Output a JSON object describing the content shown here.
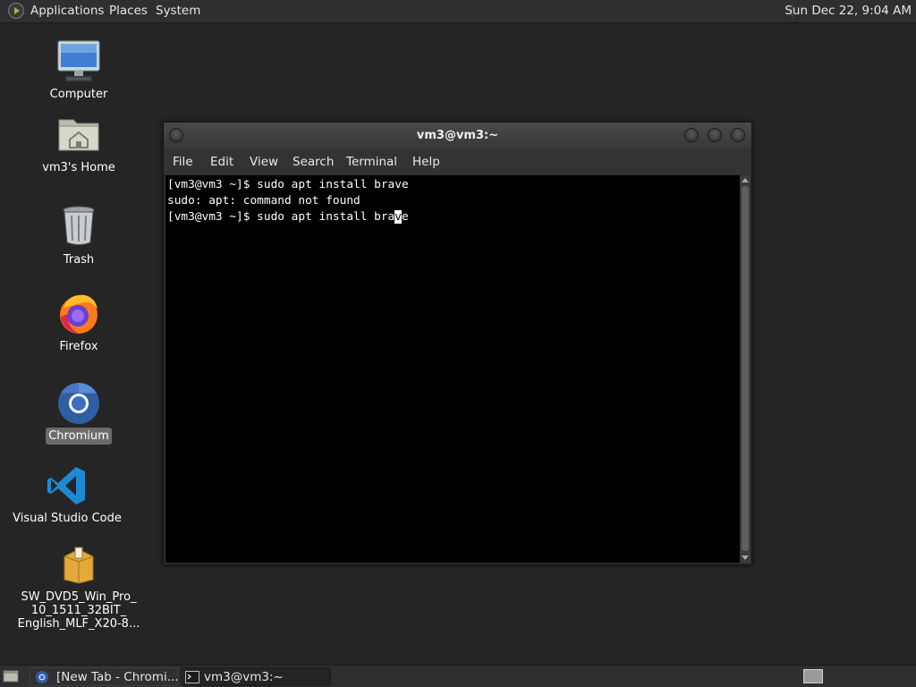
{
  "top_panel": {
    "menus": [
      "Applications",
      "Places",
      "System"
    ],
    "clock": "Sun Dec 22,  9:04 AM"
  },
  "desktop": {
    "icons": [
      {
        "label": "Computer",
        "icon": "computer-icon",
        "selected": false
      },
      {
        "label": "vm3's Home",
        "icon": "home-folder-icon",
        "selected": false
      },
      {
        "label": "Trash",
        "icon": "trash-icon",
        "selected": false
      },
      {
        "label": "Firefox",
        "icon": "firefox-icon",
        "selected": false
      },
      {
        "label": "Chromium",
        "icon": "chromium-icon",
        "selected": true
      },
      {
        "label": "Visual Studio Code",
        "icon": "vscode-icon",
        "selected": false
      },
      {
        "label_lines": [
          "SW_DVD5_Win_Pro_",
          "10_1511_32BIT_",
          "English_MLF_X20-8..."
        ],
        "icon": "archive-package-icon",
        "selected": false
      }
    ]
  },
  "terminal": {
    "title": "vm3@vm3:~",
    "menu": [
      "File",
      "Edit",
      "View",
      "Search",
      "Terminal",
      "Help"
    ],
    "lines": [
      "[vm3@vm3 ~]$ sudo apt install brave",
      "sudo: apt: command not found"
    ],
    "current_prompt": "[vm3@vm3 ~]$ sudo apt install bra",
    "cursor_char": "v",
    "after_cursor": "e"
  },
  "taskbar": {
    "tasks": [
      {
        "label": "[New Tab - Chromi...",
        "icon": "chromium-icon",
        "active": false
      },
      {
        "label": "vm3@vm3:~",
        "icon": "terminal-icon",
        "active": true
      }
    ]
  },
  "colors": {
    "desktop_bg": "#252525",
    "panel_bg": "#2f2f2f",
    "terminal_bg": "#000000",
    "terminal_fg": "#ffffff",
    "selected_label_bg": "#6b6b6b"
  }
}
